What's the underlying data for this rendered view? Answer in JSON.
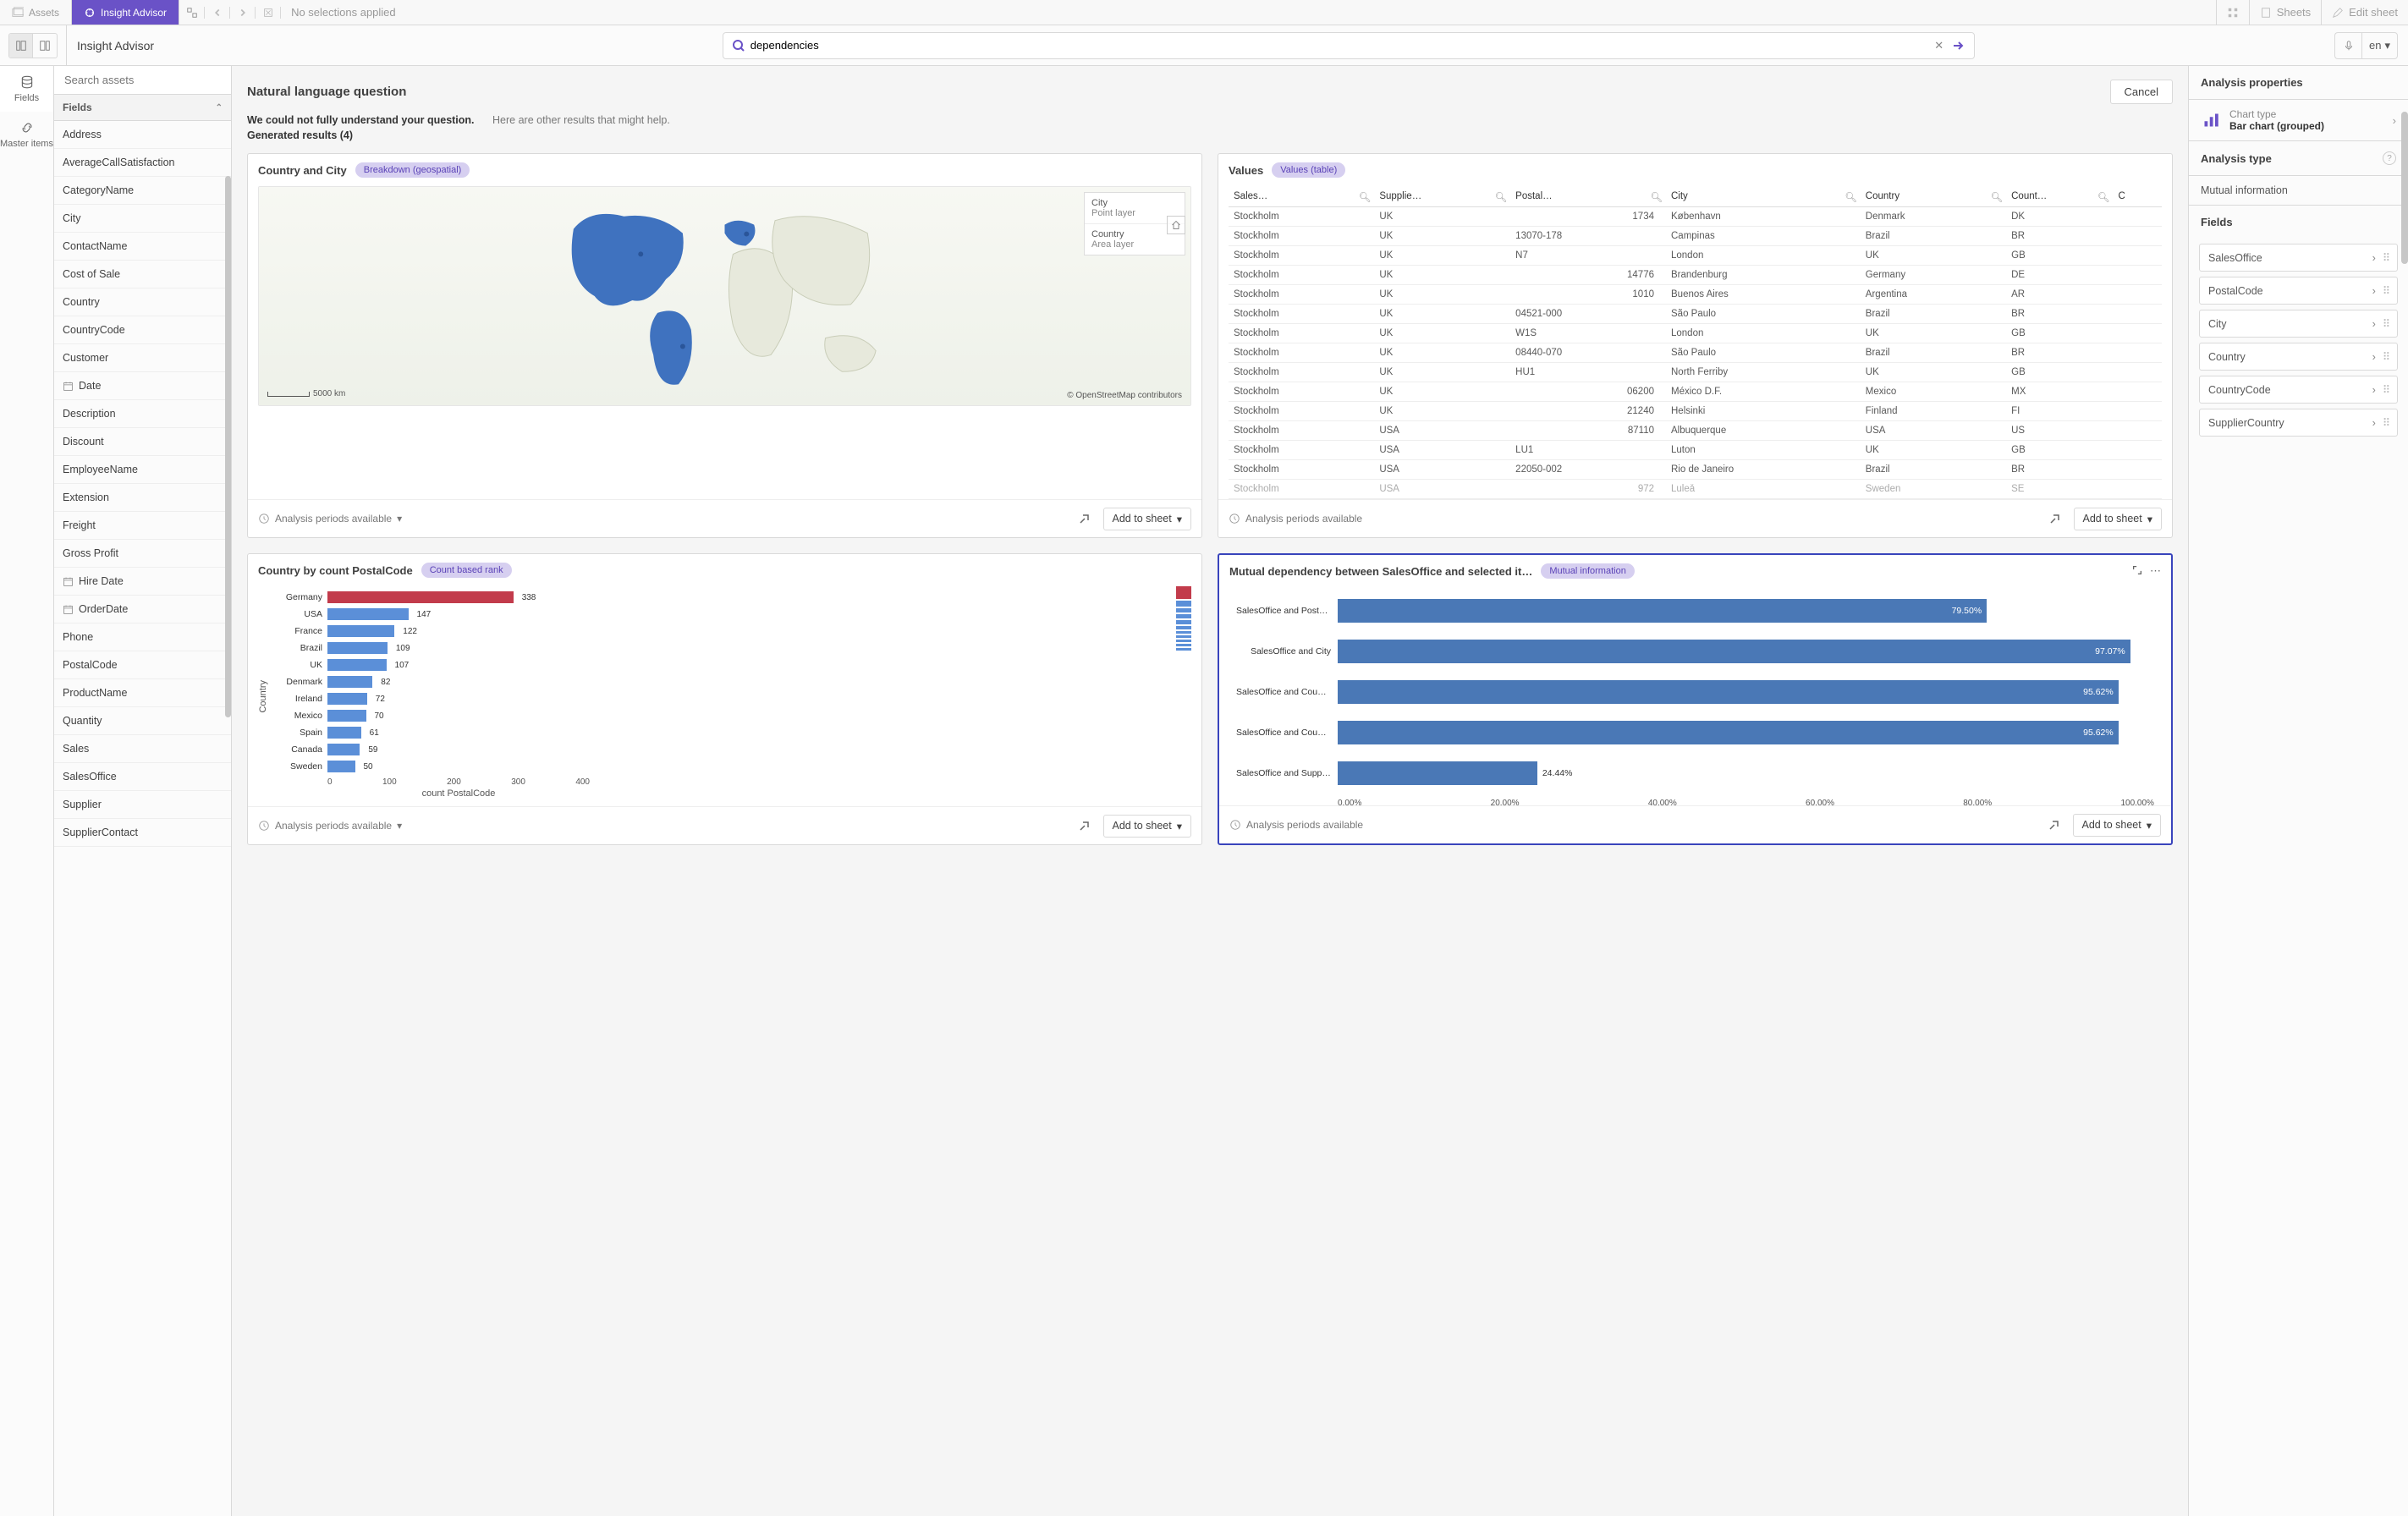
{
  "topbar": {
    "assets": "Assets",
    "insight_advisor": "Insight Advisor",
    "no_selections": "No selections applied",
    "sheets": "Sheets",
    "edit_sheet": "Edit sheet"
  },
  "secondbar": {
    "title": "Insight Advisor",
    "search_value": "dependencies",
    "lang": "en"
  },
  "rail": {
    "fields": "Fields",
    "master": "Master items"
  },
  "side": {
    "search_placeholder": "Search assets",
    "fields_header": "Fields",
    "items": [
      "Address",
      "AverageCallSatisfaction",
      "CategoryName",
      "City",
      "ContactName",
      "Cost of Sale",
      "Country",
      "CountryCode",
      "Customer",
      "Date",
      "Description",
      "Discount",
      "EmployeeName",
      "Extension",
      "Freight",
      "Gross Profit",
      "Hire Date",
      "OrderDate",
      "Phone",
      "PostalCode",
      "ProductName",
      "Quantity",
      "Sales",
      "SalesOffice",
      "Supplier",
      "SupplierContact"
    ],
    "item_icons": {
      "Date": "calendar",
      "Hire Date": "calendar",
      "OrderDate": "calendar"
    }
  },
  "content": {
    "heading": "Natural language question",
    "cancel": "Cancel",
    "warn": "We could not fully understand your question.",
    "hint": "Here are other results that might help.",
    "generated": "Generated results (4)",
    "periods": "Analysis periods available",
    "add_to_sheet": "Add to sheet"
  },
  "card_map": {
    "title": "Country and City",
    "badge": "Breakdown (geospatial)",
    "legend": {
      "city": "City",
      "point": "Point layer",
      "country": "Country",
      "area": "Area layer"
    },
    "scale": "5000 km",
    "copy": "© OpenStreetMap contributors"
  },
  "card_values": {
    "title": "Values",
    "badge": "Values (table)",
    "columns": [
      "Sales…",
      "Supplie…",
      "Postal…",
      "City",
      "Country",
      "Count…",
      "C"
    ],
    "rows": [
      [
        "Stockholm",
        "UK",
        "1734",
        "København",
        "Denmark",
        "DK",
        ""
      ],
      [
        "Stockholm",
        "UK",
        "13070-178",
        "Campinas",
        "Brazil",
        "BR",
        ""
      ],
      [
        "Stockholm",
        "UK",
        "N7",
        "London",
        "UK",
        "GB",
        ""
      ],
      [
        "Stockholm",
        "UK",
        "14776",
        "Brandenburg",
        "Germany",
        "DE",
        ""
      ],
      [
        "Stockholm",
        "UK",
        "1010",
        "Buenos Aires",
        "Argentina",
        "AR",
        ""
      ],
      [
        "Stockholm",
        "UK",
        "04521-000",
        "São Paulo",
        "Brazil",
        "BR",
        ""
      ],
      [
        "Stockholm",
        "UK",
        "W1S",
        "London",
        "UK",
        "GB",
        ""
      ],
      [
        "Stockholm",
        "UK",
        "08440-070",
        "São Paulo",
        "Brazil",
        "BR",
        ""
      ],
      [
        "Stockholm",
        "UK",
        "HU1",
        "North Ferriby",
        "UK",
        "GB",
        ""
      ],
      [
        "Stockholm",
        "UK",
        "06200",
        "México D.F.",
        "Mexico",
        "MX",
        ""
      ],
      [
        "Stockholm",
        "UK",
        "21240",
        "Helsinki",
        "Finland",
        "FI",
        ""
      ],
      [
        "Stockholm",
        "USA",
        "87110",
        "Albuquerque",
        "USA",
        "US",
        ""
      ],
      [
        "Stockholm",
        "USA",
        "LU1",
        "Luton",
        "UK",
        "GB",
        ""
      ],
      [
        "Stockholm",
        "USA",
        "22050-002",
        "Rio de Janeiro",
        "Brazil",
        "BR",
        ""
      ],
      [
        "Stockholm",
        "USA",
        "972",
        "Luleå",
        "Sweden",
        "SE",
        ""
      ]
    ]
  },
  "card_bar": {
    "title": "Country by count PostalCode",
    "badge": "Count based rank",
    "ylabel": "Country",
    "xlabel": "count PostalCode",
    "xticks": [
      "0",
      "100",
      "200",
      "300",
      "400"
    ]
  },
  "card_mutual": {
    "title": "Mutual dependency between SalesOffice and selected it…",
    "badge": "Mutual information",
    "xticks": [
      "0.00%",
      "20.00%",
      "40.00%",
      "60.00%",
      "80.00%",
      "100.00%"
    ]
  },
  "props": {
    "header": "Analysis properties",
    "chart_type_label": "Chart type",
    "chart_type_value": "Bar chart (grouped)",
    "analysis_type": "Analysis type",
    "mutual_info": "Mutual information",
    "fields_header": "Fields",
    "fields": [
      "SalesOffice",
      "PostalCode",
      "City",
      "Country",
      "CountryCode",
      "SupplierCountry"
    ]
  },
  "chart_data": [
    {
      "id": "country_by_count_postalcode",
      "type": "bar",
      "orientation": "horizontal",
      "title": "Country by count PostalCode",
      "xlabel": "count PostalCode",
      "ylabel": "Country",
      "xlim": [
        0,
        400
      ],
      "categories": [
        "Germany",
        "USA",
        "France",
        "Brazil",
        "UK",
        "Denmark",
        "Ireland",
        "Mexico",
        "Spain",
        "Canada",
        "Sweden"
      ],
      "values": [
        338,
        147,
        122,
        109,
        107,
        82,
        72,
        70,
        61,
        59,
        50
      ],
      "highlight_index": 0,
      "xticks": [
        0,
        100,
        200,
        300,
        400
      ]
    },
    {
      "id": "mutual_dependency",
      "type": "bar",
      "orientation": "horizontal",
      "title": "Mutual dependency between SalesOffice and selected items",
      "xlabel": "",
      "ylabel": "",
      "xlim": [
        0,
        100
      ],
      "value_format": "percent",
      "categories": [
        "SalesOffice and PostalCode",
        "SalesOffice and City",
        "SalesOffice and Country",
        "SalesOffice and CountryCo…",
        "SalesOffice and SupplierC…"
      ],
      "values": [
        79.5,
        97.07,
        95.62,
        95.62,
        24.44
      ],
      "xticks": [
        0,
        20,
        40,
        60,
        80,
        100
      ]
    }
  ]
}
